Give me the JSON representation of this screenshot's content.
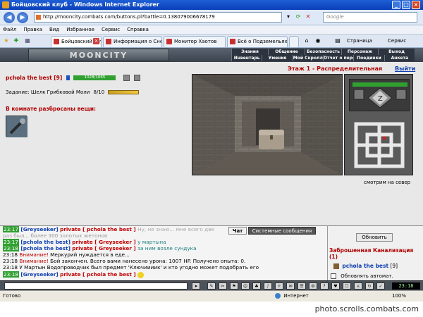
{
  "window": {
    "title": "Бойцовский клуб - Windows Internet Explorer"
  },
  "address": {
    "url": "http://mooncity.combats.com/buttons.pl?battle=0.138079006678179",
    "search_placeholder": "Google"
  },
  "menu": [
    "Файл",
    "Правка",
    "Вид",
    "Избранное",
    "Сервис",
    "Справка"
  ],
  "tabs": [
    {
      "label": "Бойцовский клуб",
      "active": true
    },
    {
      "label": "Информация о Снегу...",
      "active": false
    },
    {
      "label": "Монитор Хаотов",
      "active": false
    },
    {
      "label": "Всё о Подземельях -...",
      "active": false
    }
  ],
  "commands": {
    "page": "Страница",
    "tools": "Сервис"
  },
  "game": {
    "logo": "MOONCITY",
    "menu_top": [
      "Знания",
      "Общение",
      "Безопасность",
      "Персонаж",
      "Выход"
    ],
    "menu_bottom": [
      "Инвентарь",
      "Умения",
      "Мой Скролл",
      "Отчет о переводах",
      "Поединки",
      "Анкета"
    ]
  },
  "player": {
    "name": "pchola the best",
    "level": "[9]",
    "hp": "1028/1065"
  },
  "task": {
    "label": "Задание: Шелк Грибковой Моли",
    "progress": "8/10"
  },
  "items": {
    "title": "В комнате разбросаны вещи:"
  },
  "floor": {
    "title": "Этаж 1 - Распределительная",
    "exit": "Выйти"
  },
  "view": {
    "label": "смотрим на север"
  },
  "chat_tabs": {
    "chat": "Чат",
    "system": "Системные сообщения"
  },
  "chat": [
    {
      "time": "23:17",
      "kind": "user",
      "from": "[Greyseeker]",
      "tag": "private [ pchola the best ]",
      "text": "Ну, не знаю... мне всего две"
    },
    {
      "time": "",
      "kind": "faded",
      "text": "раз был... более 300 золотых жетонов"
    },
    {
      "time": "23:17",
      "kind": "user",
      "from": "[pchola the best]",
      "tag": "private [ Greyseeker ]",
      "text": "у мартына"
    },
    {
      "time": "23:18",
      "kind": "user",
      "from": "[pchola the best]",
      "tag": "private [ Greyseeker ]",
      "text": "за ним возле сундука"
    },
    {
      "time": "23:18",
      "kind": "warn",
      "prefix": "Внимание!",
      "text": "Меркурий нуждается в еде..."
    },
    {
      "time": "23:18",
      "kind": "warn",
      "prefix": "Внимание!",
      "text": "Бой закончен. Всего вами нанесено урона: 1007 HP. Получено опыта: 0."
    },
    {
      "time": "23:18",
      "kind": "info",
      "text": "У Мартын Водопроводчик был предмет 'Ключиииик' и кто угодно может подобрать его"
    },
    {
      "time": "23:18",
      "kind": "user",
      "from": "[Greyseeker]",
      "tag": "private [ pchola the best ]",
      "text": ""
    }
  ],
  "side": {
    "refresh": "Обновить",
    "location": "Заброшенная Канализация (1)",
    "user": "pchola the best",
    "user_level": "[9]",
    "auto": "Обновлять автомат."
  },
  "clock": "23:18",
  "status": {
    "left": "Готово",
    "zone": "Интернет",
    "zoom": "100%"
  },
  "watermark": "photo.scrolls.combats.com"
}
